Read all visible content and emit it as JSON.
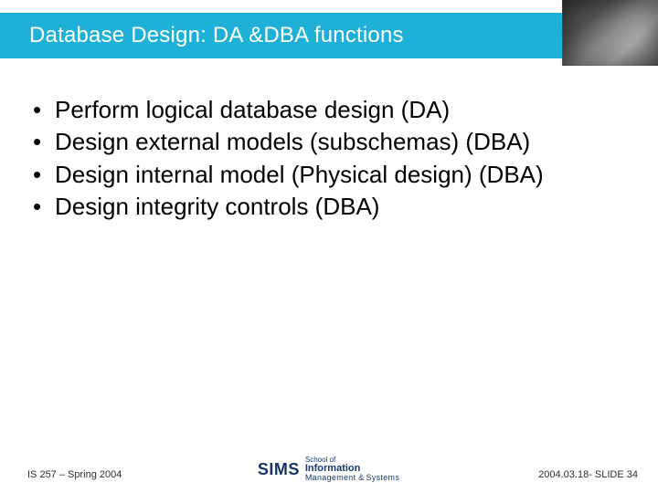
{
  "header": {
    "title": "Database Design: DA &DBA functions"
  },
  "bullets": [
    "Perform logical database design (DA)",
    "Design external models (subschemas) (DBA)",
    "Design internal model (Physical design) (DBA)",
    "Design integrity controls (DBA)"
  ],
  "footer": {
    "left": "IS 257 – Spring 2004",
    "right": "2004.03.18- SLIDE 34",
    "logo": {
      "mark": "SIMS",
      "line1": "School of",
      "line2": "Information",
      "line3_prefix": "Management",
      "line3_suffix": "Systems",
      "amp": "&"
    }
  }
}
